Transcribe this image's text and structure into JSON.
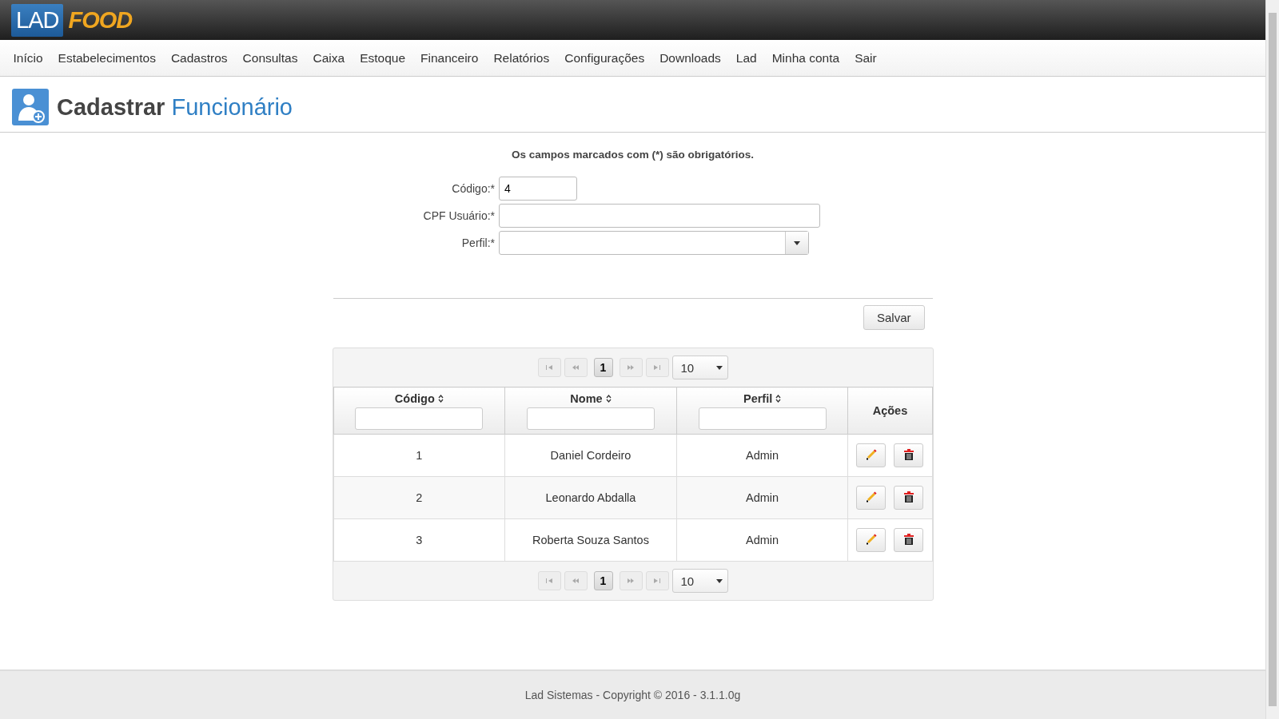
{
  "logo": {
    "left": "LAD",
    "right": "FOOD"
  },
  "nav": [
    "Início",
    "Estabelecimentos",
    "Cadastros",
    "Consultas",
    "Caixa",
    "Estoque",
    "Financeiro",
    "Relatórios",
    "Configurações",
    "Downloads",
    "Lad",
    "Minha conta",
    "Sair"
  ],
  "page_title": {
    "verb": "Cadastrar",
    "noun": "Funcionário"
  },
  "form": {
    "notice": "Os campos marcados com (*) são obrigatórios.",
    "fields": [
      {
        "kind": "text",
        "label": "Código:*",
        "value": "4"
      },
      {
        "kind": "text",
        "label": "CPF Usuário:*"
      },
      {
        "kind": "select",
        "label": "Perfil:*"
      }
    ],
    "save": "Salvar"
  },
  "table": {
    "pager_top": {
      "page": "1",
      "per_page": "10"
    },
    "columns": [
      {
        "kind": "sortable",
        "label": "Código"
      },
      {
        "kind": "sortable",
        "label": "Nome"
      },
      {
        "kind": "sortable",
        "label": "Perfil"
      },
      {
        "kind": "plain",
        "label": "Ações"
      }
    ],
    "rows": [
      {
        "code": "1",
        "name": "Daniel Cordeiro",
        "profile": "Admin"
      },
      {
        "code": "2",
        "name": "Leonardo Abdalla",
        "profile": "Admin"
      },
      {
        "code": "3",
        "name": "Roberta Souza Santos",
        "profile": "Admin"
      }
    ],
    "pager_bottom": {
      "page": "1",
      "per_page": "10"
    }
  },
  "footer": "Lad Sistemas - Copyright © 2016 - 3.1.1.0g"
}
